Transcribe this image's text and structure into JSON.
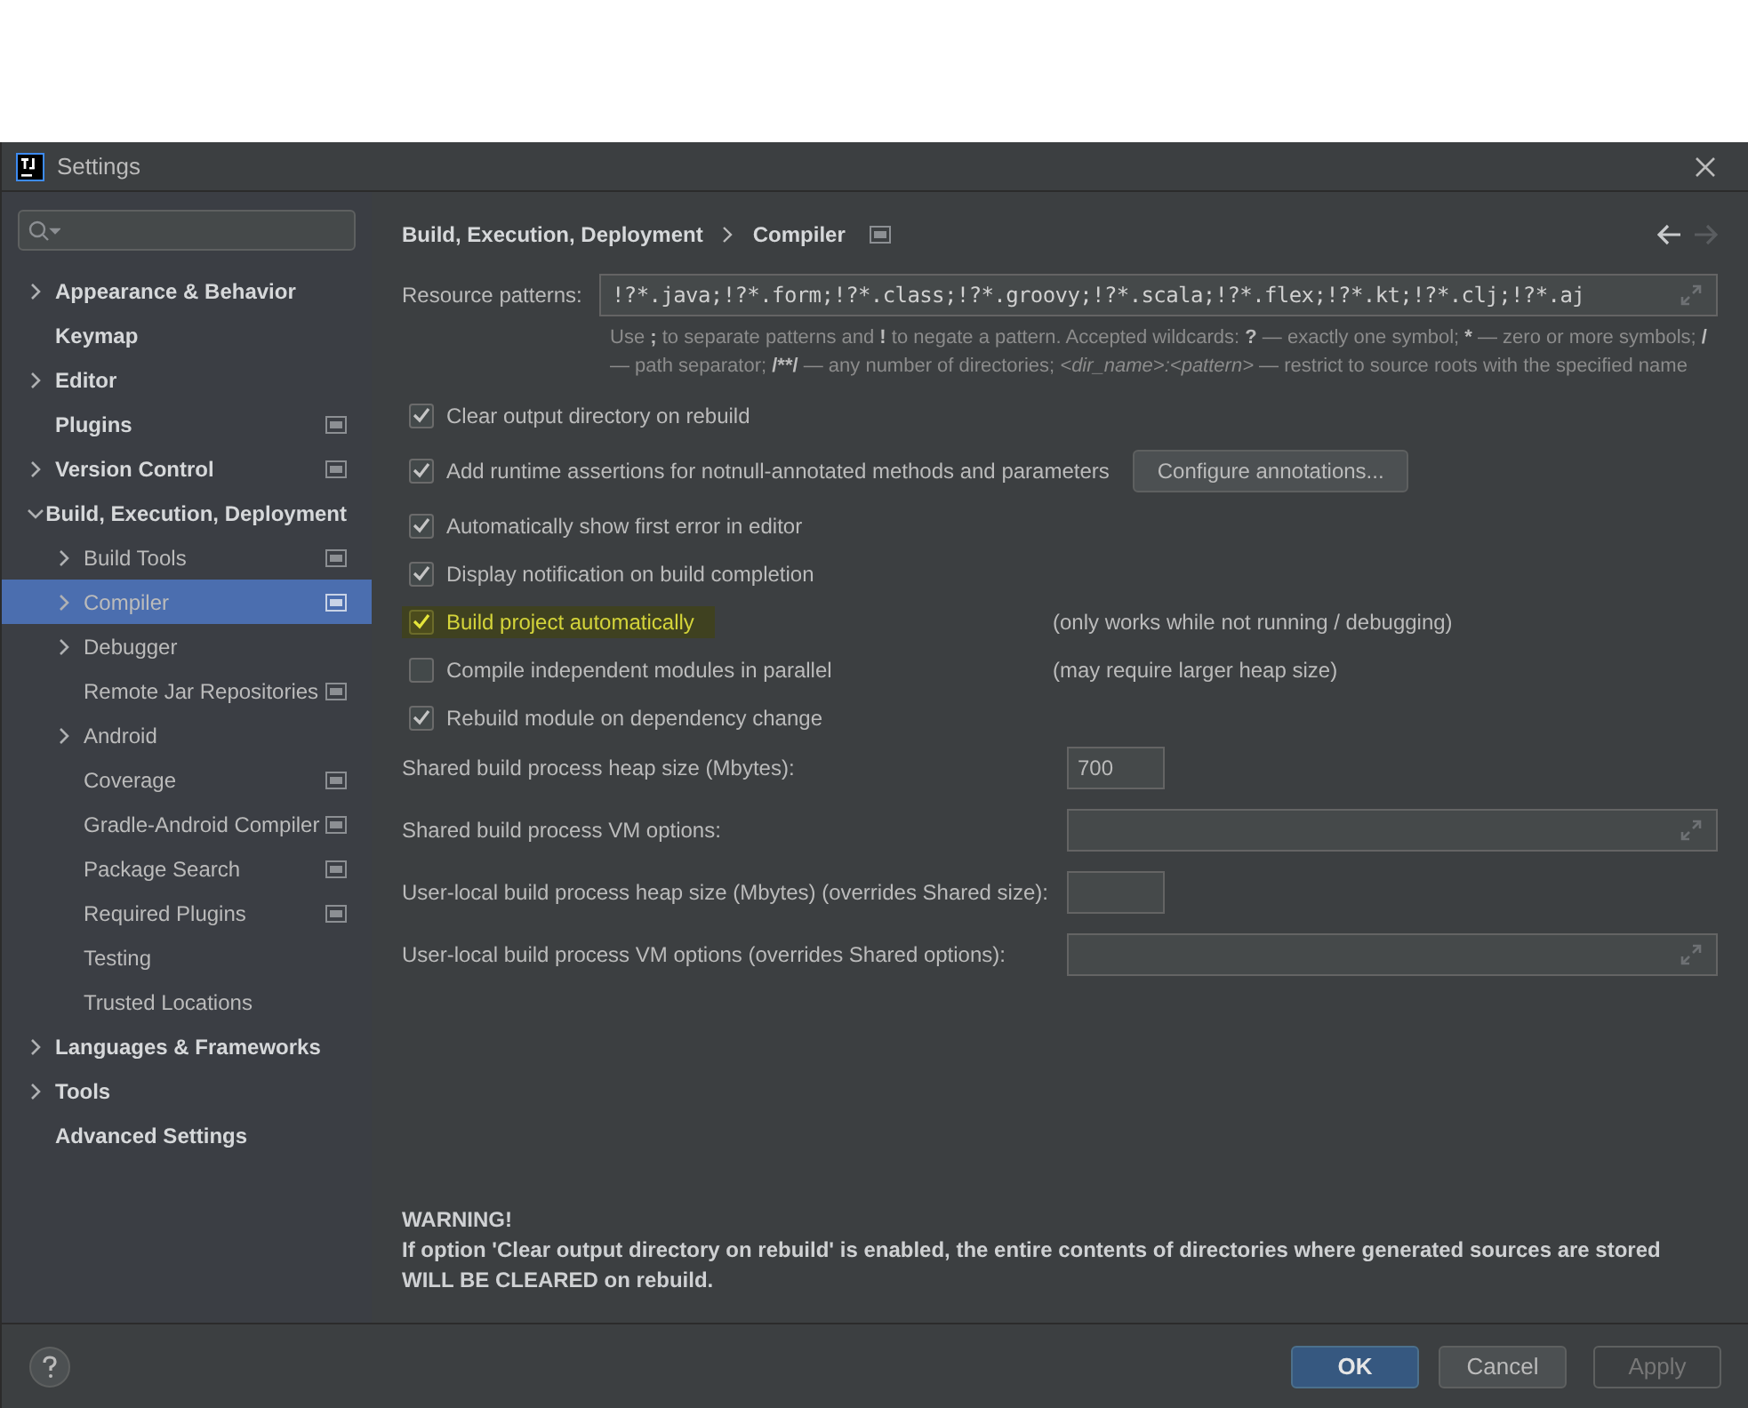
{
  "window": {
    "title": "Settings"
  },
  "sidebar": {
    "items": [
      {
        "label": "Appearance & Behavior",
        "kind": "folder",
        "expanded": false,
        "selected": false,
        "project_level": false
      },
      {
        "label": "Keymap",
        "kind": "page",
        "selected": false,
        "project_level": false
      },
      {
        "label": "Editor",
        "kind": "folder",
        "expanded": false,
        "selected": false,
        "project_level": false
      },
      {
        "label": "Plugins",
        "kind": "page",
        "selected": false,
        "project_level": true
      },
      {
        "label": "Version Control",
        "kind": "folder",
        "expanded": false,
        "selected": false,
        "project_level": true
      },
      {
        "label": "Build, Execution, Deployment",
        "kind": "folder",
        "expanded": true,
        "selected": false,
        "project_level": false,
        "children": [
          {
            "label": "Build Tools",
            "kind": "folder",
            "expanded": false,
            "selected": false,
            "project_level": true
          },
          {
            "label": "Compiler",
            "kind": "folder",
            "expanded": false,
            "selected": true,
            "project_level": true
          },
          {
            "label": "Debugger",
            "kind": "folder",
            "expanded": false,
            "selected": false,
            "project_level": false
          },
          {
            "label": "Remote Jar Repositories",
            "kind": "page",
            "selected": false,
            "project_level": true
          },
          {
            "label": "Android",
            "kind": "folder",
            "expanded": false,
            "selected": false,
            "project_level": false
          },
          {
            "label": "Coverage",
            "kind": "page",
            "selected": false,
            "project_level": true
          },
          {
            "label": "Gradle-Android Compiler",
            "kind": "page",
            "selected": false,
            "project_level": true
          },
          {
            "label": "Package Search",
            "kind": "page",
            "selected": false,
            "project_level": true
          },
          {
            "label": "Required Plugins",
            "kind": "page",
            "selected": false,
            "project_level": true
          },
          {
            "label": "Testing",
            "kind": "page",
            "selected": false,
            "project_level": false
          },
          {
            "label": "Trusted Locations",
            "kind": "page",
            "selected": false,
            "project_level": false
          }
        ]
      },
      {
        "label": "Languages & Frameworks",
        "kind": "folder",
        "expanded": false,
        "selected": false,
        "project_level": false
      },
      {
        "label": "Tools",
        "kind": "folder",
        "expanded": false,
        "selected": false,
        "project_level": false
      },
      {
        "label": "Advanced Settings",
        "kind": "page",
        "selected": false,
        "project_level": false
      }
    ]
  },
  "breadcrumb": {
    "parent": "Build, Execution, Deployment",
    "current": "Compiler",
    "project_level": true,
    "back_disabled": false,
    "forward_disabled": true
  },
  "resource_patterns": {
    "label": "Resource patterns:",
    "value": "!?*.java;!?*.form;!?*.class;!?*.groovy;!?*.scala;!?*.flex;!?*.kt;!?*.clj;!?*.aj",
    "hint": [
      {
        "text": "Use ",
        "kind": "plain"
      },
      {
        "text": ";",
        "kind": "bold"
      },
      {
        "text": " to separate patterns and ",
        "kind": "plain"
      },
      {
        "text": "!",
        "kind": "bold"
      },
      {
        "text": " to negate a pattern. Accepted wildcards: ",
        "kind": "plain"
      },
      {
        "text": "?",
        "kind": "bold"
      },
      {
        "text": " — exactly one symbol; ",
        "kind": "plain"
      },
      {
        "text": "*",
        "kind": "bold"
      },
      {
        "text": " — zero or more symbols; ",
        "kind": "plain"
      },
      {
        "text": "/",
        "kind": "bold"
      },
      {
        "text": " — path separator; ",
        "kind": "plain"
      },
      {
        "text": "/**/",
        "kind": "bold"
      },
      {
        "text": " — any number of directories; ",
        "kind": "plain"
      },
      {
        "text": "<dir_name>:<pattern>",
        "kind": "italic"
      },
      {
        "text": " — restrict to source roots with the specified name",
        "kind": "plain"
      }
    ]
  },
  "options": [
    {
      "label": "Clear output directory on rebuild",
      "checked": true,
      "highlighted": false
    },
    {
      "label": "Add runtime assertions for notnull-annotated methods and parameters",
      "checked": true,
      "highlighted": false,
      "button": "Configure annotations..."
    },
    {
      "label": "Automatically show first error in editor",
      "checked": true,
      "highlighted": false
    },
    {
      "label": "Display notification on build completion",
      "checked": true,
      "highlighted": false
    },
    {
      "label": "Build project automatically",
      "checked": true,
      "highlighted": true,
      "note": "(only works while not running / debugging)"
    },
    {
      "label": "Compile independent modules in parallel",
      "checked": false,
      "highlighted": false,
      "note": "(may require larger heap size)"
    },
    {
      "label": "Rebuild module on dependency change",
      "checked": true,
      "highlighted": false
    }
  ],
  "fields": [
    {
      "label": "Shared build process heap size (Mbytes):",
      "kind": "number",
      "value": "700"
    },
    {
      "label": "Shared build process VM options:",
      "kind": "text"
    },
    {
      "label": "User-local build process heap size (Mbytes) (overrides Shared size):",
      "kind": "number"
    },
    {
      "label": "User-local build process VM options (overrides Shared options):",
      "kind": "text"
    }
  ],
  "warning": {
    "title": "WARNING!",
    "text": "If option 'Clear output directory on rebuild' is enabled, the entire contents of directories where generated sources are stored WILL BE CLEARED on rebuild."
  },
  "buttons": [
    {
      "label": "OK",
      "kind": "primary",
      "disabled": false
    },
    {
      "label": "Cancel",
      "kind": "normal",
      "disabled": false
    },
    {
      "label": "Apply",
      "kind": "normal",
      "disabled": true
    }
  ]
}
